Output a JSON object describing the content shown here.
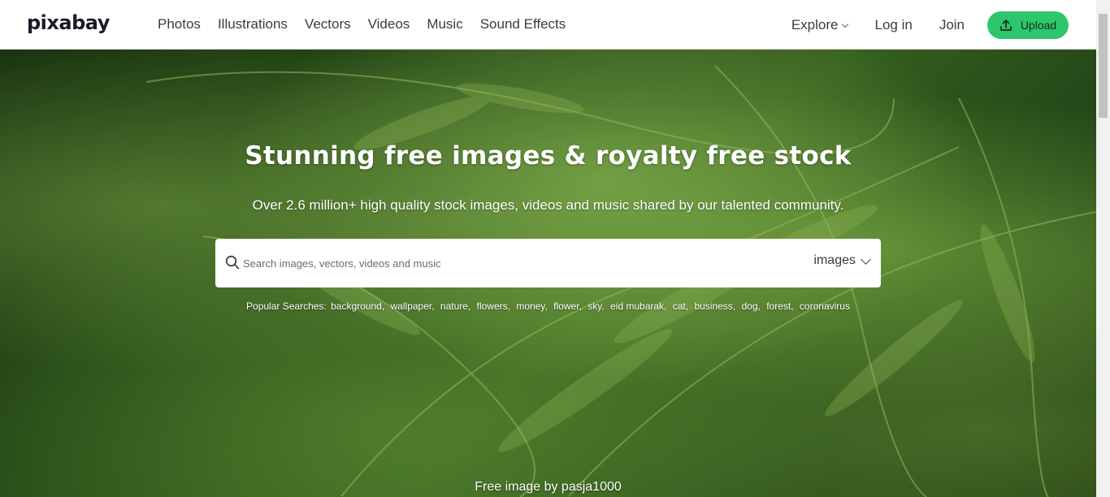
{
  "header": {
    "logo": "pixabay",
    "nav": [
      "Photos",
      "Illustrations",
      "Vectors",
      "Videos",
      "Music",
      "Sound Effects"
    ],
    "explore_label": "Explore",
    "login_label": "Log in",
    "join_label": "Join",
    "upload_label": "Upload"
  },
  "hero": {
    "title": "Stunning free images & royalty free stock",
    "subtitle": "Over 2.6 million+ high quality stock images, videos and music shared by our talented community.",
    "search": {
      "placeholder": "Search images, vectors, videos and music",
      "value": "",
      "type_selected": "images"
    },
    "popular_label": "Popular Searches:",
    "popular_searches": [
      "background",
      "wallpaper",
      "nature",
      "flowers",
      "money",
      "flower",
      "sky",
      "eid mubarak",
      "cat",
      "business",
      "dog",
      "forest",
      "coronavirus"
    ],
    "credit": "Free image by pasja1000"
  },
  "colors": {
    "upload_button": "#2ec66d",
    "header_bg": "#ffffff",
    "hero_text": "#ffffff"
  }
}
